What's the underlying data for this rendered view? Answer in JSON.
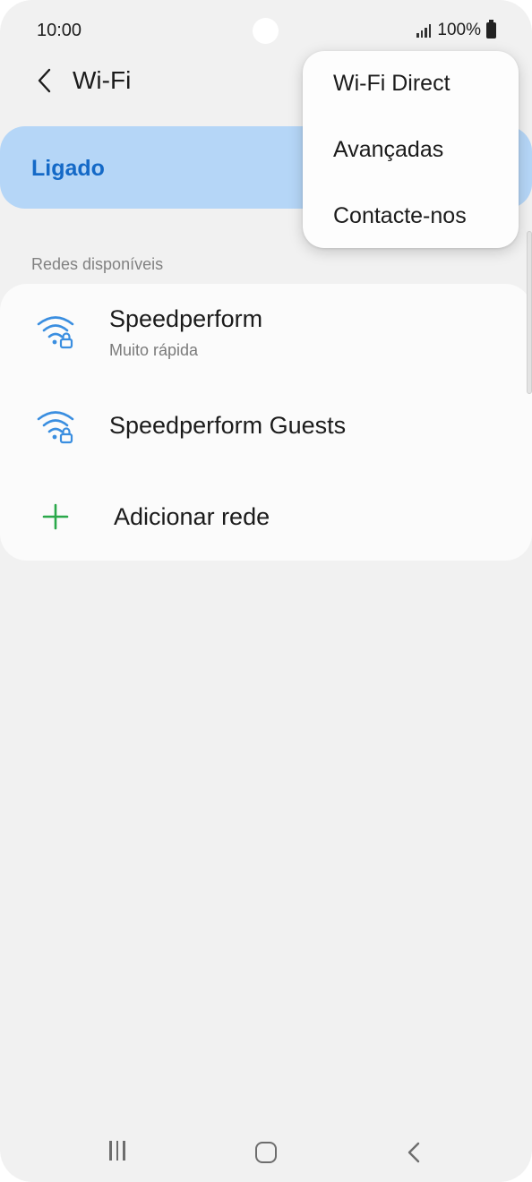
{
  "status_bar": {
    "time": "10:00",
    "battery_text": "100%"
  },
  "header": {
    "title": "Wi-Fi",
    "back_icon": "chevron-left-icon"
  },
  "wifi_toggle": {
    "label": "Ligado"
  },
  "available_networks": {
    "section_title": "Redes disponíveis",
    "networks": [
      {
        "name": "Speedperform",
        "subtitle": "Muito rápida",
        "icon": "wifi-lock-icon"
      },
      {
        "name": "Speedperform Guests",
        "icon": "wifi-lock-icon"
      }
    ],
    "add_network_label": "Adicionar rede"
  },
  "overflow_menu": {
    "items": [
      {
        "label": "Wi-Fi Direct"
      },
      {
        "label": "Avançadas"
      },
      {
        "label": "Contacte-nos"
      }
    ]
  },
  "colors": {
    "accent": "#1469c7",
    "toggle_background": "#b5d6f7",
    "wifi_icon": "#3a8ee0",
    "add_icon": "#2aa84a"
  }
}
